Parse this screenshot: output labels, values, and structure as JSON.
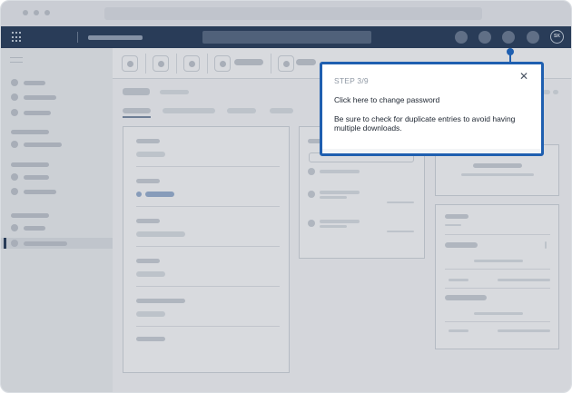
{
  "header": {
    "avatar_initials": "SK"
  },
  "tour": {
    "step_label": "STEP 3/9",
    "title": "Click here to change password",
    "body": "Be sure to check for duplicate entries to avoid having multiple downloads.",
    "close_icon": "close-icon",
    "close_glyph": "✕"
  },
  "colors": {
    "topbar": "#2a3f5c",
    "accent": "#1f5fb0"
  }
}
